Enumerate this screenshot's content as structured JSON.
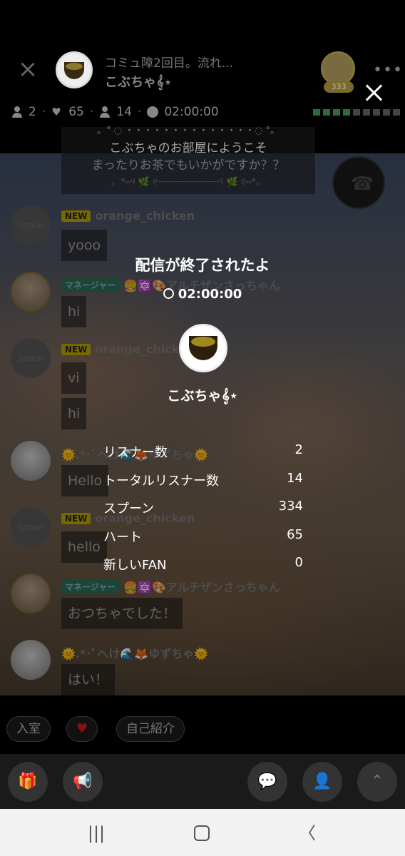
{
  "header": {
    "live_title": "コミュ障2回目。流れ...",
    "host_name": "こぶちゃ𝄞⋆",
    "top_badge": "333",
    "more": "•••"
  },
  "stats": {
    "listeners": "2",
    "hearts": "65",
    "fans": "14",
    "duration": "02:00:00"
  },
  "chat": {
    "welcome_lines": [
      "。°  ◌ ・・・・・・・・・・・・・・◌ °。",
      "こぶちゃのお部屋にようこそ",
      "まったりお茶でもいかがですか？？",
      "。*⑅୨ 🌿 ୧┈┈┈┈┈┈┈┈┈┈┈୨ 🌿 ୧⑅*。"
    ],
    "messages": [
      {
        "tag": "NEW",
        "nick": "orange_chicken",
        "texts": [
          "yooo"
        ]
      },
      {
        "tag": "マネージャー",
        "nick": "🍔🔯🎨アルチザンさっちゃん",
        "texts": [
          "hi"
        ]
      },
      {
        "tag": "NEW",
        "nick": "orange_chicken",
        "texts": [
          "vi",
          "hi"
        ]
      },
      {
        "tag": "",
        "nick": "🌞.*･ﾟへけ🌊🦊ゆずちゃ🌞",
        "texts": [
          "Hello"
        ]
      },
      {
        "tag": "NEW",
        "nick": "orange_chicken",
        "texts": [
          "hello"
        ]
      },
      {
        "tag": "マネージャー",
        "nick": "🍔🔯🎨アルチザンさっちゃん",
        "texts": [
          "おつちゃでした！"
        ]
      },
      {
        "tag": "",
        "nick": "🌞.*･ﾟへけ🌊🦊ゆずちゃ🌞",
        "texts": [
          "はい！"
        ]
      }
    ],
    "default_avatar_label": "Spoon"
  },
  "end_modal": {
    "title": "配信が終了されたよ",
    "duration": "02:00:00",
    "host_name": "こぶちゃ𝄞⋆",
    "rows": [
      {
        "label": "リスナー数",
        "value": "2"
      },
      {
        "label": "トータルリスナー数",
        "value": "14"
      },
      {
        "label": "スプーン",
        "value": "334"
      },
      {
        "label": "ハート",
        "value": "65"
      },
      {
        "label": "新しいFAN",
        "value": "0"
      }
    ]
  },
  "chips": {
    "enter": "入室",
    "heart": "♥",
    "intro": "自己紹介"
  },
  "icons": {
    "close": "×",
    "heart": "♥",
    "phone": "☎",
    "gift": "🎁",
    "speaker": "📢",
    "chat": "💬",
    "profile": "👤",
    "up": "⌃",
    "nav_recent": "|||",
    "nav_back": "〈"
  }
}
